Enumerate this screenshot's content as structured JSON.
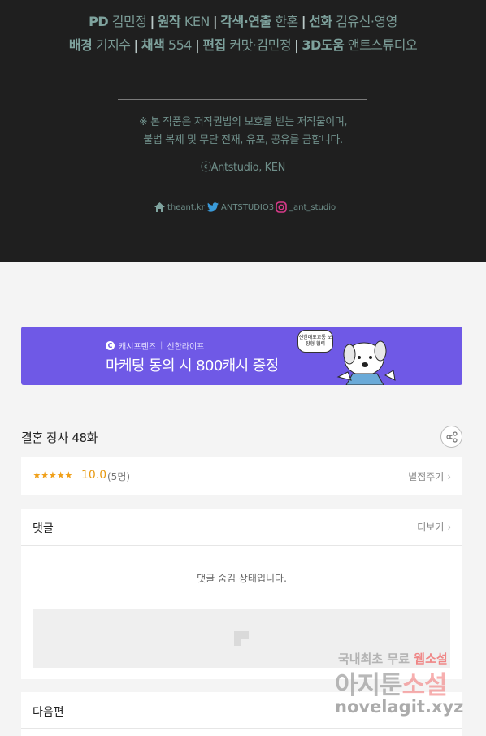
{
  "credits": {
    "line1": [
      {
        "role": "PD",
        "name": "김민정"
      },
      {
        "role": "원작",
        "name": "KEN"
      },
      {
        "role": "각색·연출",
        "name": "한혼"
      },
      {
        "role": "선화",
        "name": "김유신·영영"
      }
    ],
    "line2": [
      {
        "role": "배경",
        "name": "기지수"
      },
      {
        "role": "채색",
        "name": "554"
      },
      {
        "role": "편집",
        "name": "커맛·김민정"
      },
      {
        "role": "3D도움",
        "name": "앤트스튜디오"
      }
    ],
    "notice_line1": "※ 본 작품은 저작권법의 보호를 받는 저작물이며,",
    "notice_line2": "불법 복제 및 무단 전재, 유포, 공유를 금합니다.",
    "copyright": "ⓒAntstudio, KEN",
    "social": {
      "home": "theant.kr",
      "twitter": "ANTSTUDIO3",
      "instagram": "_ant_studio"
    }
  },
  "banner": {
    "brand": "캐시프렌즈",
    "partner": "신한라이프",
    "headline": "마케팅 동의 시 800캐시 증정",
    "bubble_text": "신한대표교통 보장형 협력",
    "color": "#6f59e6"
  },
  "episode": {
    "title": "결혼 장사 48화"
  },
  "rating": {
    "stars": "★★★★★",
    "score": "10.0",
    "count": "(5명)",
    "rate_label": "별점주기"
  },
  "comments": {
    "header": "댓글",
    "more_label": "더보기",
    "hidden_message": "댓글 숨김 상태입니다."
  },
  "next_episode": {
    "label": "다음편"
  },
  "watermark": {
    "line1_a": "국내최초 무료",
    "line1_b": "웹소설",
    "line2_a": "아지툰",
    "line2_b": "소설",
    "line3": "novelagit.xyz"
  }
}
